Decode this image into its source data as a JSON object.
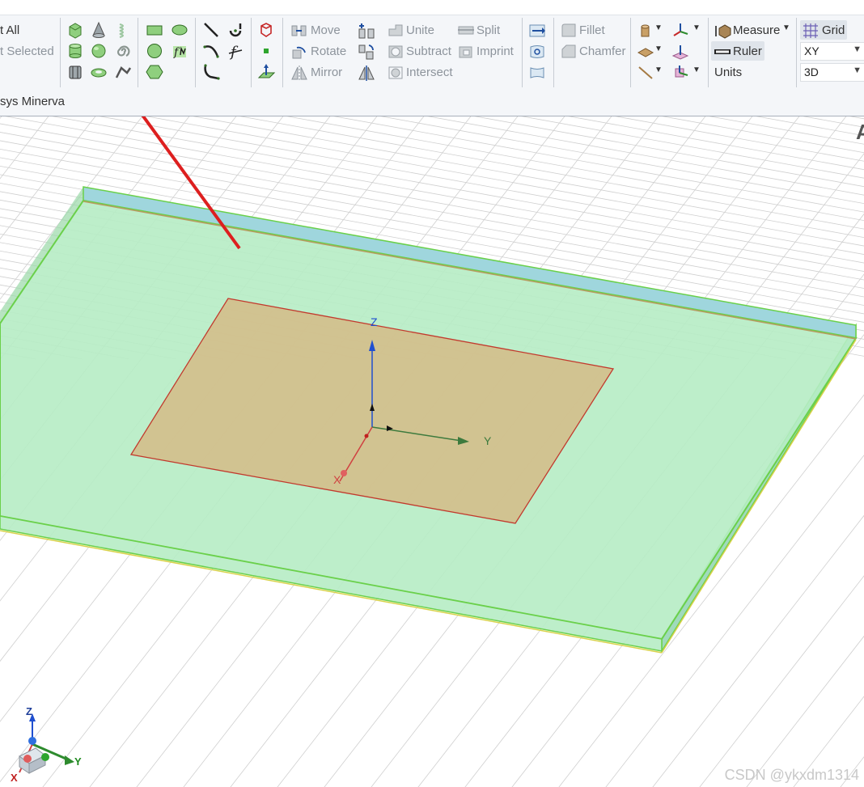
{
  "ribbon": {
    "select_all_label": "t All",
    "select_selected_label": "t Selected",
    "section_label": "sys Minerva",
    "transform": {
      "move": "Move",
      "rotate": "Rotate",
      "mirror": "Mirror"
    },
    "boolean": {
      "unite": "Unite",
      "subtract": "Subtract",
      "intersect": "Intersect",
      "split": "Split",
      "imprint": "Imprint"
    },
    "edit": {
      "fillet": "Fillet",
      "chamfer": "Chamfer"
    },
    "tools": {
      "measure": "Measure",
      "ruler": "Ruler",
      "units": "Units"
    },
    "grid": {
      "label": "Grid",
      "plane": "XY",
      "mode": "3D"
    }
  },
  "icons": {
    "box": "box-icon",
    "cone": "cone-icon",
    "helix": "helix-icon",
    "cylinder": "cylinder-icon",
    "sphere": "sphere-icon",
    "spiral": "spiral-icon",
    "torus": "torus-icon",
    "bondwire": "bondwire-icon",
    "rectangle": "rectangle-icon",
    "ellipse": "ellipse-icon",
    "circle": "circle-icon",
    "equation-surface": "equation-surface-icon",
    "polygon": "polygon-icon",
    "line": "line-icon",
    "arc": "arc-icon",
    "spline": "spline-icon",
    "equation-curve": "equation-curve-icon",
    "polyline": "polyline-icon",
    "region": "region-icon",
    "point": "point-icon",
    "plane": "plane-icon"
  },
  "viewport": {
    "axis_labels": {
      "x": "X",
      "y": "Y",
      "z": "Z"
    },
    "corner_label": "A",
    "watermark": "CSDN @ykxdm1314",
    "colors": {
      "substrate": "#b6ecc4",
      "substrate_edge": "#6ad04a",
      "patch": "#d2c08d",
      "patch_edge": "#c23a2e",
      "annotation": "#dd1f1f"
    }
  }
}
